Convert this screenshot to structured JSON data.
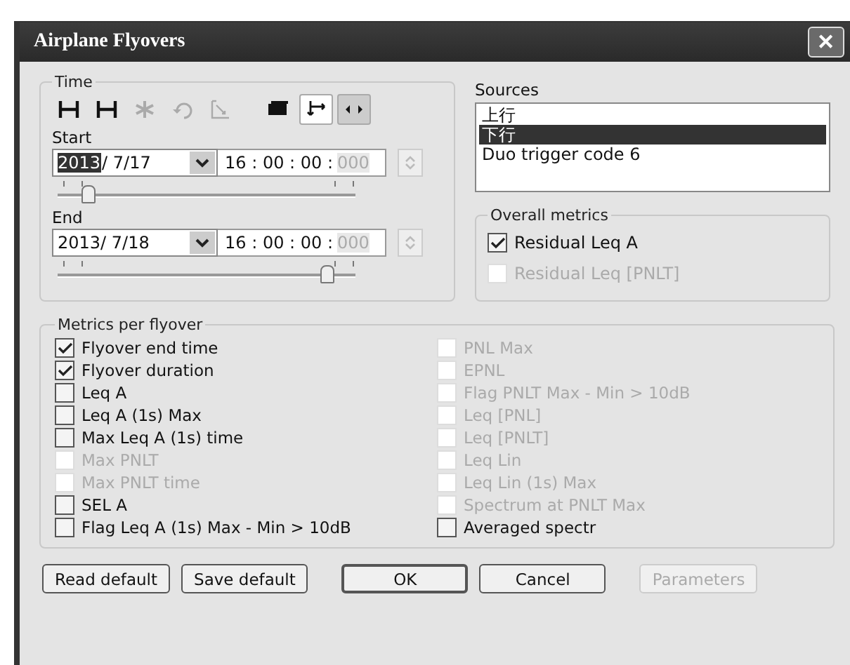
{
  "window": {
    "title": "Airplane Flyovers",
    "close": "✕"
  },
  "time": {
    "title": "Time",
    "toolbar": [
      {
        "kind": "bracket",
        "disabled": false,
        "selected": false
      },
      {
        "kind": "bracket",
        "disabled": false,
        "selected": false
      },
      {
        "kind": "star",
        "disabled": true,
        "selected": false
      },
      {
        "kind": "undo",
        "disabled": true,
        "selected": false
      },
      {
        "kind": "frame",
        "disabled": true,
        "selected": false
      },
      {
        "kind": "cards",
        "disabled": false,
        "selected": false
      },
      {
        "kind": "arrows",
        "disabled": false,
        "selected": true
      },
      {
        "kind": "leftright",
        "disabled": false,
        "selected": true
      }
    ],
    "start": {
      "label": "Start",
      "year": "2013",
      "year_selected": true,
      "date_rest": "/ 7/17",
      "time": "16 : 00 : 00 :",
      "ms": "000",
      "level": 0.1
    },
    "end": {
      "label": "End",
      "year": "2013",
      "year_selected": false,
      "date_rest": "/ 7/18",
      "time": "16 : 00 : 00 :",
      "ms": "000",
      "level": 0.9
    }
  },
  "sources": {
    "title": "Sources",
    "items": [
      {
        "label": "上行",
        "selected": false
      },
      {
        "label": "下行",
        "selected": true
      },
      {
        "label": "Duo trigger code 6",
        "selected": false
      }
    ]
  },
  "overall_metrics": {
    "title": "Overall metrics",
    "items": [
      {
        "label": "Residual Leq A",
        "checked": true,
        "disabled": false
      },
      {
        "label": "Residual Leq [PNLT]",
        "checked": false,
        "disabled": true
      }
    ]
  },
  "metrics_per_flyover": {
    "title": "Metrics per flyover",
    "columns": [
      [
        {
          "label": "Flyover end time",
          "checked": true,
          "disabled": false
        },
        {
          "label": "Flyover duration",
          "checked": true,
          "disabled": false
        },
        {
          "label": "Leq A",
          "checked": false,
          "disabled": false
        },
        {
          "label": "Leq A (1s) Max",
          "checked": false,
          "disabled": false
        },
        {
          "label": "Max Leq A (1s) time",
          "checked": false,
          "disabled": false
        },
        {
          "label": "Max PNLT",
          "checked": false,
          "disabled": true
        },
        {
          "label": "Max PNLT time",
          "checked": false,
          "disabled": true
        },
        {
          "label": "SEL A",
          "checked": false,
          "disabled": false
        },
        {
          "label": "Flag Leq A (1s) Max - Min > 10dB",
          "checked": false,
          "disabled": false
        }
      ],
      [
        {
          "label": "PNL Max",
          "checked": false,
          "disabled": true
        },
        {
          "label": "EPNL",
          "checked": false,
          "disabled": true
        },
        {
          "label": "Flag PNLT Max - Min > 10dB",
          "checked": false,
          "disabled": true
        },
        {
          "label": "Leq [PNL]",
          "checked": false,
          "disabled": true
        },
        {
          "label": "Leq [PNLT]",
          "checked": false,
          "disabled": true
        },
        {
          "label": "Leq Lin",
          "checked": false,
          "disabled": true
        },
        {
          "label": "Leq Lin (1s) Max",
          "checked": false,
          "disabled": true
        },
        {
          "label": "Spectrum at PNLT Max",
          "checked": false,
          "disabled": true
        },
        {
          "label": "Averaged spectr",
          "checked": false,
          "disabled": false
        }
      ]
    ]
  },
  "buttons": [
    {
      "label": "Read default",
      "disabled": false,
      "default": false
    },
    {
      "label": "Save default",
      "disabled": false,
      "default": false
    },
    {
      "label": "OK",
      "disabled": false,
      "default": true
    },
    {
      "label": "Cancel",
      "disabled": false,
      "default": false
    },
    {
      "label": "Parameters",
      "disabled": true,
      "default": false
    }
  ]
}
